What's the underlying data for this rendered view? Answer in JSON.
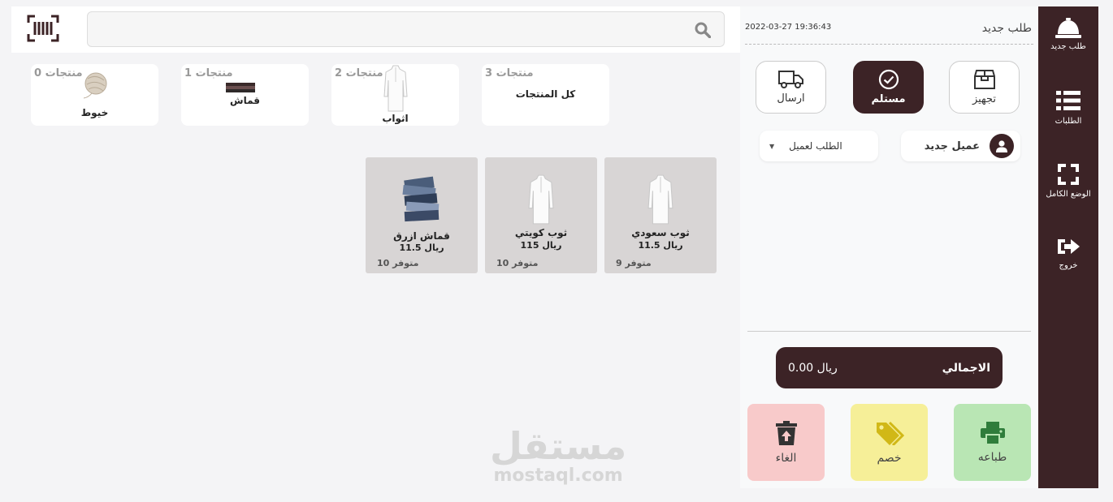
{
  "sidebar": {
    "items": [
      {
        "label": "طلب جديد",
        "icon": "bell-icon"
      },
      {
        "label": "الطلبات",
        "icon": "list-icon"
      },
      {
        "label": "الوضع الكامل",
        "icon": "fullscreen-icon"
      },
      {
        "label": "خروج",
        "icon": "logout-icon"
      }
    ]
  },
  "order": {
    "title": "طلب جديد",
    "timestamp": "2022-03-27 19:36:43",
    "statuses": [
      {
        "label": "تجهيز",
        "icon": "box-icon"
      },
      {
        "label": "مستلم",
        "icon": "check-circle-icon",
        "active": true
      },
      {
        "label": "ارسال",
        "icon": "truck-icon"
      }
    ],
    "customer_button": "عميل جديد",
    "customer_select": "الطلب لعميل",
    "total_label": "الاجمالي",
    "total_value": "0.00 ريال",
    "actions": [
      {
        "label": "طباعه",
        "icon": "print-icon",
        "color": "#b9e6b4"
      },
      {
        "label": "خصم",
        "icon": "tags-icon",
        "color": "#f6ef98"
      },
      {
        "label": "الغاء",
        "icon": "trash-icon",
        "color": "#f8caca"
      }
    ]
  },
  "search": {
    "placeholder": ""
  },
  "categories": [
    {
      "name": "كل المنتجات",
      "count": "3 منتجات"
    },
    {
      "name": "اثواب",
      "count": "2 منتجات"
    },
    {
      "name": "قماش",
      "count": "1 منتجات"
    },
    {
      "name": "خيوط",
      "count": "0 منتجات"
    }
  ],
  "products": [
    {
      "name": "ثوب سعودي",
      "price": "11.5 ريال",
      "stock": "متوفر 9"
    },
    {
      "name": "ثوب كويتي",
      "price": "115 ريال",
      "stock": "متوفر 10"
    },
    {
      "name": "قماش ازرق",
      "price": "11.5 ريال",
      "stock": "متوفر 10"
    }
  ],
  "watermark": {
    "arabic": "مستقل",
    "latin": "mostaql.com"
  },
  "colors": {
    "brand": "#3c2326",
    "print": "#b9e6b4",
    "discount": "#f6ef98",
    "cancel": "#f8caca",
    "product_card": "#d8d5d5"
  }
}
